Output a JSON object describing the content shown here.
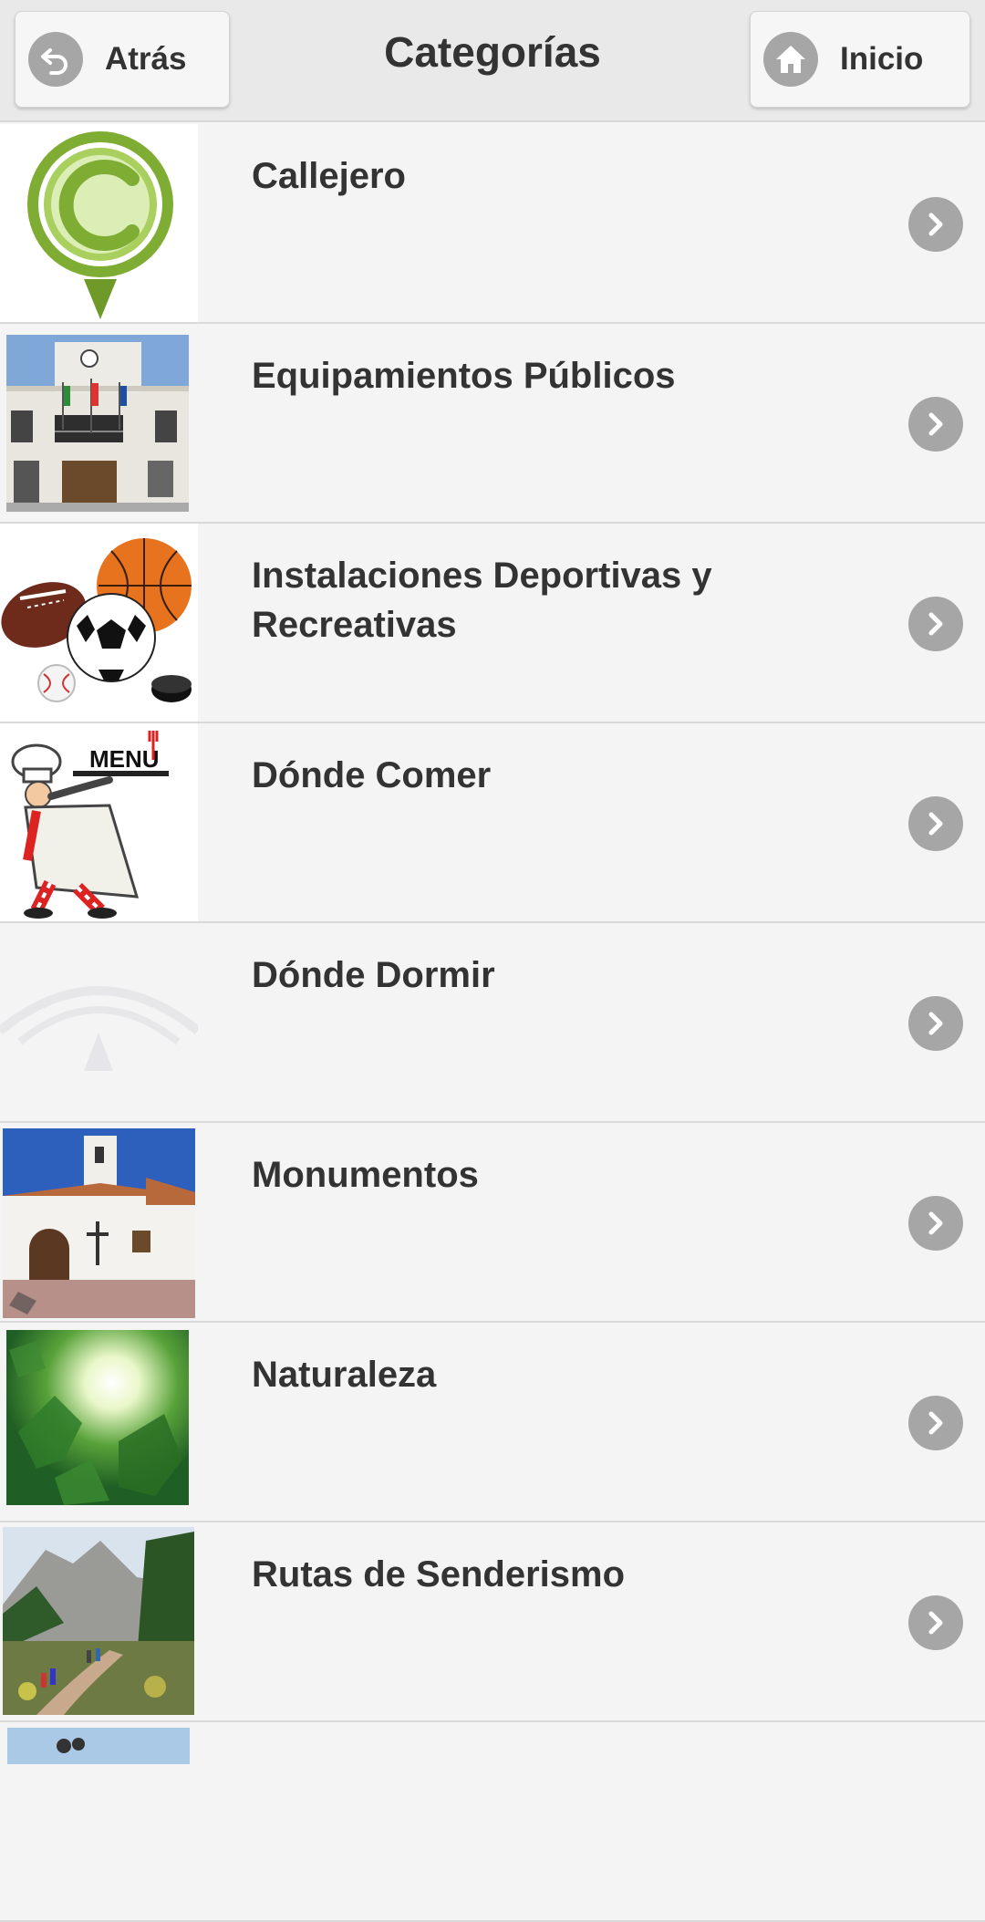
{
  "header": {
    "title": "Categorías",
    "back_label": "Atrás",
    "home_label": "Inicio"
  },
  "icons": {
    "back": "back-arrow-icon",
    "home": "home-icon",
    "row_chevron": "chevron-right-icon"
  },
  "colors": {
    "header_bg": "#e9e9e9",
    "list_bg": "#f4f4f4",
    "icon_circle": "#a6a6a6",
    "text": "#333333"
  },
  "categories": [
    {
      "label": "Callejero",
      "thumbnail": "map-pin-c-logo"
    },
    {
      "label": "Equipamientos Públicos",
      "thumbnail": "town-hall-photo"
    },
    {
      "label": "Instalaciones Deportivas y Recreativas",
      "thumbnail": "sports-balls-image"
    },
    {
      "label": "Dónde Comer",
      "thumbnail": "chef-menu-illustration"
    },
    {
      "label": "Dónde Dormir",
      "thumbnail": "faded-andalucia-logo"
    },
    {
      "label": "Monumentos",
      "thumbnail": "church-photo"
    },
    {
      "label": "Naturaleza",
      "thumbnail": "leaves-sunlight-photo"
    },
    {
      "label": "Rutas de Senderismo",
      "thumbnail": "hiking-trail-photo"
    }
  ],
  "menu_sign_text": "MENU"
}
